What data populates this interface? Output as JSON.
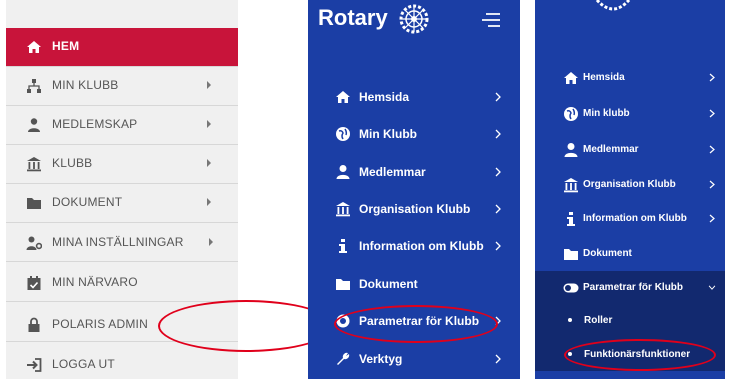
{
  "panel1": {
    "items": [
      {
        "label": "HEM",
        "icon": "home-icon",
        "active": true
      },
      {
        "label": "MIN KLUBB",
        "icon": "org-chart-icon",
        "chevron": true
      },
      {
        "label": "MEDLEMSKAP",
        "icon": "user-icon",
        "chevron": true
      },
      {
        "label": "KLUBB",
        "icon": "building-icon",
        "chevron": true
      },
      {
        "label": "DOKUMENT",
        "icon": "folder-icon",
        "chevron": true
      },
      {
        "label": "MINA INSTÄLLNINGAR",
        "icon": "users-gear-icon",
        "chevron": true
      },
      {
        "label": "MIN NÄRVARO",
        "icon": "calendar-check-icon"
      },
      {
        "label": "POLARIS ADMIN",
        "icon": "lock-icon"
      },
      {
        "label": "LOGGA UT",
        "icon": "logout-icon"
      }
    ],
    "colors": {
      "active": "#c8143a",
      "bg": "#f0f0f0",
      "text": "#555555"
    }
  },
  "panel2": {
    "brand": "Rotary",
    "items": [
      {
        "label": "Hemsida",
        "icon": "home-icon"
      },
      {
        "label": "Min Klubb",
        "icon": "globe-icon"
      },
      {
        "label": "Medlemmar",
        "icon": "user-icon"
      },
      {
        "label": "Organisation Klubb",
        "icon": "building-icon"
      },
      {
        "label": "Information om Klubb",
        "icon": "info-icon"
      },
      {
        "label": "Dokument",
        "icon": "folder-icon"
      },
      {
        "label": "Parametrar för Klubb",
        "icon": "toggle-icon"
      },
      {
        "label": "Verktyg",
        "icon": "wrench-icon"
      }
    ],
    "colors": {
      "bg": "#1b3ea5",
      "text": "#ffffff"
    }
  },
  "panel3": {
    "items": [
      {
        "label": "Hemsida",
        "icon": "home-icon"
      },
      {
        "label": "Min klubb",
        "icon": "globe-icon"
      },
      {
        "label": "Medlemmar",
        "icon": "user-icon"
      },
      {
        "label": "Organisation Klubb",
        "icon": "building-icon"
      },
      {
        "label": "Information om Klubb",
        "icon": "info-icon"
      },
      {
        "label": "Dokument",
        "icon": "folder-icon"
      },
      {
        "label": "Parametrar för Klubb",
        "icon": "toggle-icon",
        "expanded": true
      }
    ],
    "subitems": [
      {
        "label": "Roller"
      },
      {
        "label": "Funktionärsfunktioner"
      }
    ],
    "colors": {
      "bg": "#1b3ea5",
      "active_bg": "#12296f",
      "text": "#ffffff"
    }
  },
  "annotation_color": "#e0001b"
}
